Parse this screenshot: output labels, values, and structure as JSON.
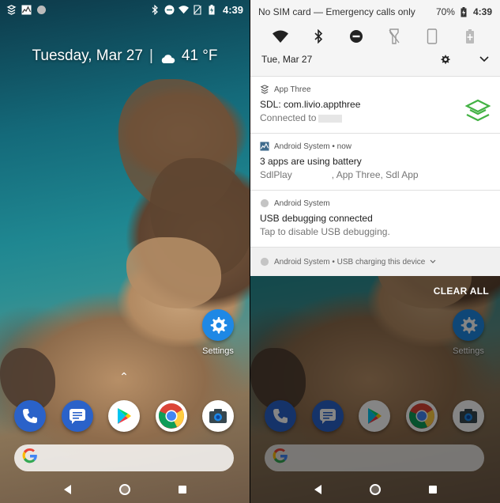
{
  "home": {
    "status_time": "4:39",
    "glance_date": "Tuesday, Mar 27",
    "glance_temp": "41 °F",
    "apps": [
      {
        "name": "Settings",
        "label": "Settings",
        "icon": "gear-icon",
        "color": "#1e88e5"
      }
    ],
    "dock": [
      {
        "icon": "phone-icon",
        "color": "#2a62c9"
      },
      {
        "icon": "messages-icon",
        "color": "#2a62c9"
      },
      {
        "icon": "play-store-icon",
        "color": "#ffffff"
      },
      {
        "icon": "chrome-icon",
        "color": "#ffffff"
      },
      {
        "icon": "camera-icon",
        "color": "#ffffff"
      }
    ],
    "search_logo": "G"
  },
  "shade": {
    "carrier": "No SIM card — Emergency calls only",
    "battery": "70%",
    "time": "4:39",
    "date": "Tue, Mar 27",
    "quick_tiles": [
      "wifi-icon",
      "bluetooth-icon",
      "do-not-disturb-icon",
      "flashlight-icon",
      "auto-rotate-icon",
      "battery-saver-icon"
    ],
    "notifications": [
      {
        "app": "App Three",
        "icon": "sdl-icon",
        "title": "SDL: com.livio.appthree",
        "text": "Connected to"
      },
      {
        "app": "Android System • now",
        "icon": "system-monitor-icon",
        "title": "3 apps are using battery",
        "text_a": "SdlPlay",
        "text_b": ", App Three, Sdl App"
      },
      {
        "app": "Android System",
        "icon": "android-system-icon",
        "title": "USB debugging connected",
        "text": "Tap to disable USB debugging."
      }
    ],
    "collapsed": "Android System • USB charging this device",
    "clear_all": "CLEAR ALL"
  },
  "colors": {
    "accent": "#1e88e5",
    "sdl_green": "#43b244"
  }
}
